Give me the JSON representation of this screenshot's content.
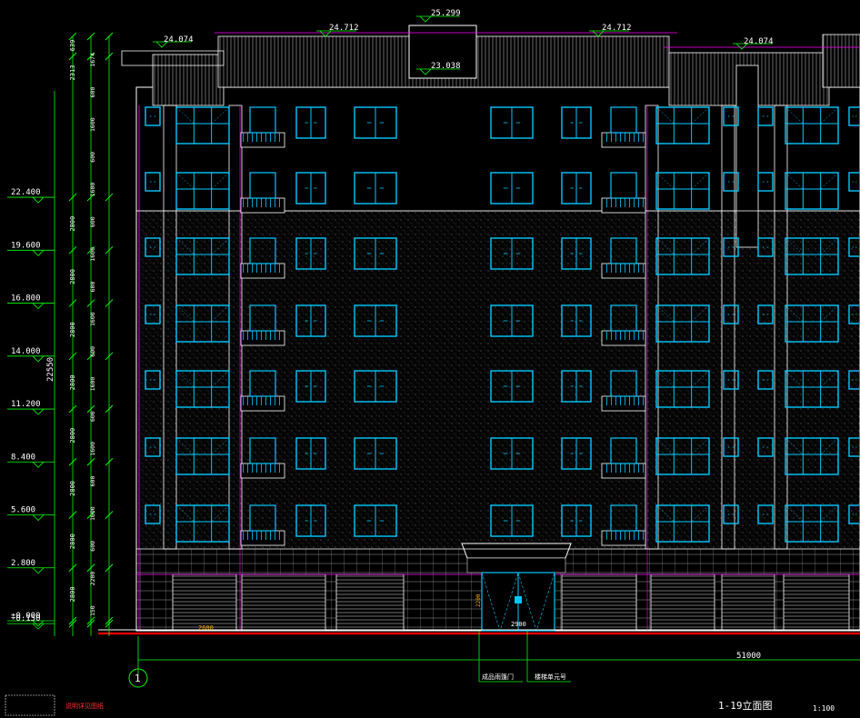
{
  "drawing": {
    "title": "1-19立面图",
    "scale": "1:100",
    "axis_bubble": "1",
    "total_width_dim": "51000",
    "total_height_dim": "22550",
    "bottom_note": "说明详见图纸",
    "callouts": [
      "成品雨篷门",
      "楼梯单元号"
    ],
    "door_width_dim": "2900",
    "shop_dim": "2600",
    "entrance_small_dim": "2200"
  },
  "levels": {
    "left": [
      {
        "label": "22.400",
        "elev": 22.4
      },
      {
        "label": "19.600",
        "elev": 19.6
      },
      {
        "label": "16.800",
        "elev": 16.8
      },
      {
        "label": "14.000",
        "elev": 14.0
      },
      {
        "label": "11.200",
        "elev": 11.2
      },
      {
        "label": "8.400",
        "elev": 8.4
      },
      {
        "label": "5.600",
        "elev": 5.6
      },
      {
        "label": "2.800",
        "elev": 2.8
      },
      {
        "label": "±0.000",
        "elev": 0.0
      },
      {
        "label": "-0.150",
        "elev": -0.15
      }
    ],
    "top": [
      {
        "label": "24.074",
        "pos": "left-roof"
      },
      {
        "label": "24.712",
        "pos": "center-left"
      },
      {
        "label": "25.299",
        "pos": "stair-top"
      },
      {
        "label": "23.038",
        "pos": "stair-inner"
      },
      {
        "label": "24.712",
        "pos": "center-right"
      },
      {
        "label": "24.074",
        "pos": "right-roof"
      }
    ]
  },
  "dims": {
    "floor_heights": [
      "2800",
      "2800",
      "2800",
      "2800",
      "2800",
      "2800",
      "2800",
      "2800",
      "2313",
      "639",
      "150"
    ],
    "inner_segments": [
      "1674",
      "600",
      "1600",
      "600",
      "1600",
      "600",
      "1600",
      "600",
      "1600",
      "600",
      "1600",
      "600",
      "1600",
      "600",
      "1600",
      "600",
      "2200",
      "150"
    ]
  },
  "colors": {
    "background": "#000000",
    "outline": "#ffffff",
    "window": "#00c8ff",
    "dimension": "#00ff00",
    "magenta": "#ff00ff",
    "level_text": "#ffffff",
    "ground": "#ff0000",
    "note_red": "#ff3030"
  }
}
